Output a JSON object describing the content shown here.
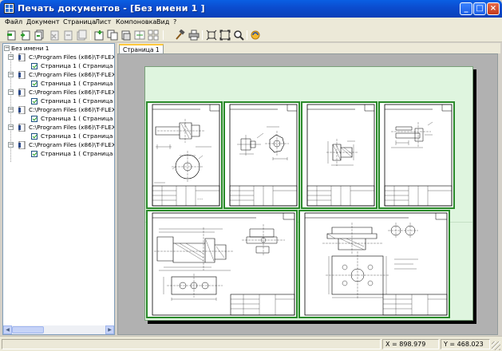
{
  "window": {
    "title": "Печать документов - [Без имени 1 ]",
    "controls": [
      "_",
      "□",
      "×"
    ]
  },
  "menu": [
    "Файл",
    "Документ",
    "Страница",
    "Лист",
    "Компоновка",
    "Вид",
    "?"
  ],
  "toolbar": {
    "icons": [
      "add-document-icon",
      "add-page-icon",
      "add-pages-icon",
      "delete-document-icon",
      "delete-page-icon",
      "delete-all-icon",
      "new-sheet-icon",
      "copy-sheet-icon",
      "paste-sheet-icon",
      "arrange-icon",
      "arrange-all-icon",
      "hammer-icon",
      "print-icon",
      "fit-width-icon",
      "fit-page-icon",
      "zoom-icon",
      "refresh-icon"
    ]
  },
  "tree": {
    "root": "Без имени 1",
    "documents": [
      {
        "path": "C:\\Program Files (x86)\\T-FLEX\\",
        "page": "Страница 1 ( Страница 1 )"
      },
      {
        "path": "C:\\Program Files (x86)\\T-FLEX\\",
        "page": "Страница 1 ( Страница 1 )"
      },
      {
        "path": "C:\\Program Files (x86)\\T-FLEX\\",
        "page": "Страница 1 ( Страница 1 )"
      },
      {
        "path": "C:\\Program Files (x86)\\T-FLEX\\",
        "page": "Страница 1 ( Страница 1 )"
      },
      {
        "path": "C:\\Program Files (x86)\\T-FLEX\\",
        "page": "Страница 1 ( Страница 1 )"
      },
      {
        "path": "C:\\Program Files (x86)\\T-FLEX\\",
        "page": "Страница 1 ( Страница 1 )"
      }
    ]
  },
  "tab": {
    "label": "Страница 1"
  },
  "status": {
    "x": "X = 898.979",
    "y": "Y = 468.023"
  },
  "colors": {
    "page_border": "#2a8a2a",
    "sheet": "#dff5df",
    "canvas": "#b1b1b1",
    "titlebar": "#0b4dd0"
  }
}
